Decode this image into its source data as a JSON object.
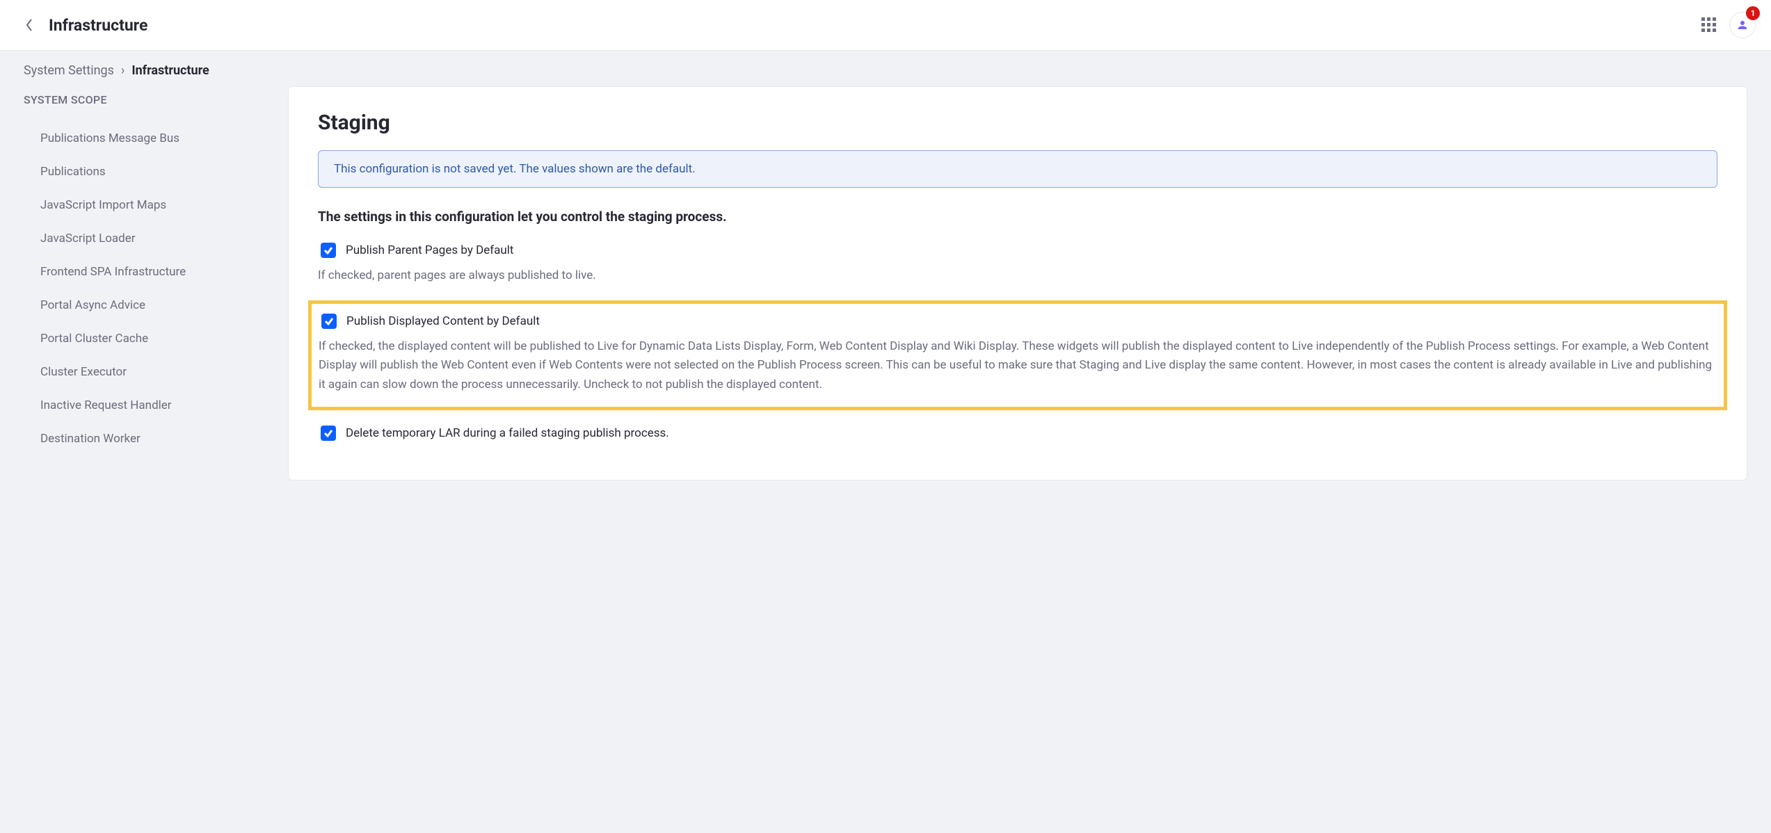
{
  "header": {
    "title": "Infrastructure",
    "notification_count": "1"
  },
  "breadcrumb": {
    "parent": "System Settings",
    "current": "Infrastructure"
  },
  "sidebar": {
    "scope_label": "SYSTEM SCOPE",
    "items": [
      "Publications Message Bus",
      "Publications",
      "JavaScript Import Maps",
      "JavaScript Loader",
      "Frontend SPA Infrastructure",
      "Portal Async Advice",
      "Portal Cluster Cache",
      "Cluster Executor",
      "Inactive Request Handler",
      "Destination Worker"
    ]
  },
  "main": {
    "heading": "Staging",
    "banner": "This configuration is not saved yet. The values shown are the default.",
    "description": "The settings in this configuration let you control the staging process.",
    "settings": [
      {
        "label": "Publish Parent Pages by Default",
        "help": "If checked, parent pages are always published to live.",
        "checked": true,
        "highlighted": false
      },
      {
        "label": "Publish Displayed Content by Default",
        "help": "If checked, the displayed content will be published to Live for Dynamic Data Lists Display, Form, Web Content Display and Wiki Display. These widgets will publish the displayed content to Live independently of the Publish Process settings. For example, a Web Content Display will publish the Web Content even if Web Contents were not selected on the Publish Process screen. This can be useful to make sure that Staging and Live display the same content. However, in most cases the content is already available in Live and publishing it again can slow down the process unnecessarily. Uncheck to not publish the displayed content.",
        "checked": true,
        "highlighted": true
      },
      {
        "label": "Delete temporary LAR during a failed staging publish process.",
        "help": "",
        "checked": true,
        "highlighted": false
      }
    ]
  }
}
